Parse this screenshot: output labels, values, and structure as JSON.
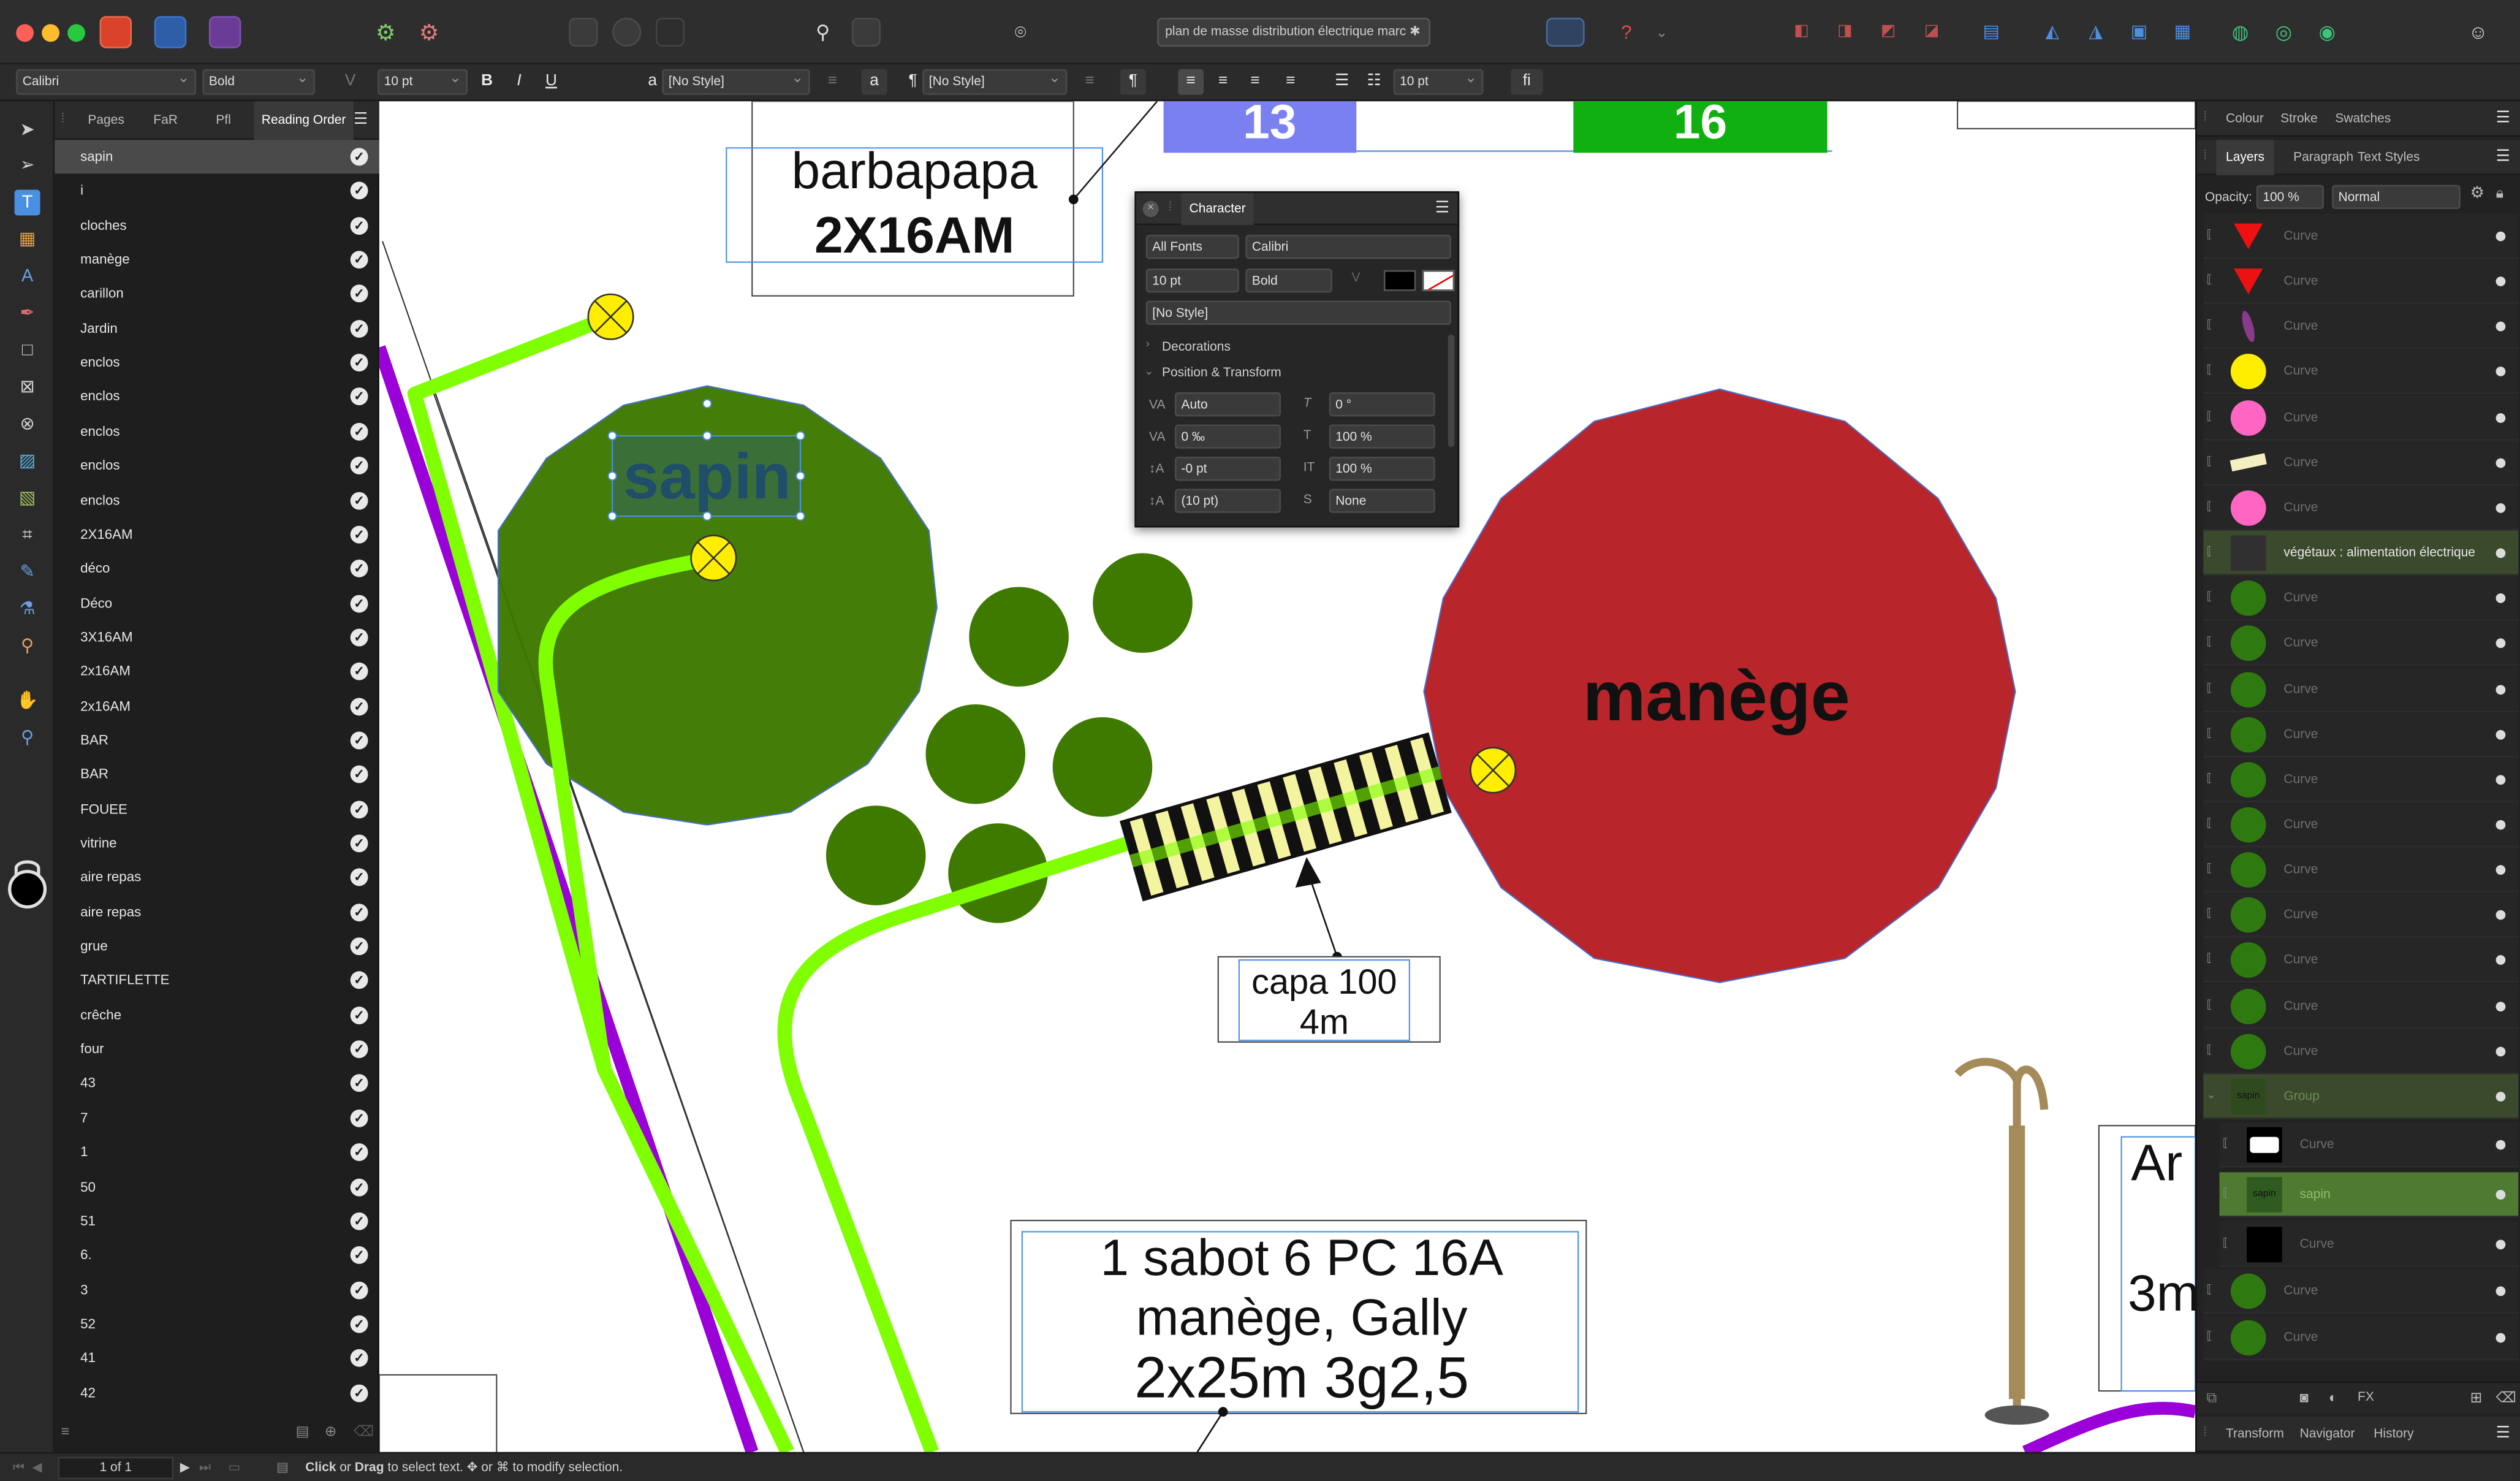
{
  "titlebar": {
    "document_name": "plan de masse distribution électrique marc",
    "modified_marker": "✱"
  },
  "context_toolbar": {
    "font_family": "Calibri",
    "font_style": "Bold",
    "font_size": "10 pt",
    "bold": "B",
    "italic": "I",
    "underline": "U",
    "char_style_prefix": "a",
    "char_style": "[No Style]",
    "para_style_prefix": "¶",
    "para_style": "[No Style]",
    "para_size": "10 pt",
    "ligature": "fi",
    "lowercase_a": "a",
    "pilcrow": "¶"
  },
  "left_panel": {
    "tabs": [
      "Pages",
      "FaR",
      "Pfl",
      "Reading Order"
    ],
    "active_tab": "Reading Order",
    "items": [
      "sapin",
      "i",
      "cloches",
      "manège",
      "carillon",
      "Jardin",
      "enclos",
      "enclos",
      "enclos",
      "enclos",
      "enclos",
      "2X16AM",
      "déco",
      "Déco",
      "3X16AM",
      "2x16AM",
      "2x16AM",
      "BAR",
      "BAR",
      "FOUEE",
      "vitrine",
      "aire repas",
      "aire repas",
      "grue",
      "TARTIFLETTE",
      "crêche",
      "four",
      "43",
      "7",
      "1",
      "50",
      "51",
      "6.",
      "3",
      "52",
      "41",
      "42"
    ],
    "selected_index": 0
  },
  "canvas": {
    "label_13": "13",
    "label_16": "16",
    "barbapapa_line1": "barbapapa",
    "barbapapa_line2": "2X16AM",
    "sapin": "sapin",
    "manege": "manège",
    "capa_line1": "capa 100",
    "capa_line2": "4m",
    "sabot_line1": "1 sabot 6 PC 16A",
    "sabot_line2": "manège, Gally",
    "sabot_line3": "2x25m 3g2,5",
    "ar_line1": "Ar",
    "ar_line2": "3m"
  },
  "character_panel": {
    "title": "Character",
    "font_collection": "All Fonts",
    "font_family": "Calibri",
    "font_size": "10 pt",
    "font_style": "Bold",
    "style": "[No Style]",
    "section_decorations": "Decorations",
    "section_position": "Position & Transform",
    "kerning": "Auto",
    "skew": "0 °",
    "tracking": "0 ‰",
    "vertical_scale": "100 %",
    "baseline": "-0 pt",
    "horizontal_scale": "100 %",
    "leading": "(10 pt)",
    "superscript": "None"
  },
  "right_panel": {
    "top_tabs": [
      "Colour",
      "Stroke",
      "Swatches"
    ],
    "layer_tabs": [
      "Layers",
      "Paragraph",
      "Text Styles"
    ],
    "active_layer_tab": "Layers",
    "opacity_label": "Opacity:",
    "opacity_value": "100 %",
    "blend_mode": "Normal",
    "layers": [
      {
        "name": "Curve",
        "thumb": "red-triangle"
      },
      {
        "name": "Curve",
        "thumb": "red-triangle"
      },
      {
        "name": "Curve",
        "thumb": "purple-leaf"
      },
      {
        "name": "Curve",
        "thumb": "yellow-circle"
      },
      {
        "name": "Curve",
        "thumb": "pink-circle"
      },
      {
        "name": "Curve",
        "thumb": "beige-strip"
      },
      {
        "name": "Curve",
        "thumb": "pink-circle"
      },
      {
        "name": "végétaux : alimentation électrique",
        "thumb": "group-dark"
      },
      {
        "name": "Curve",
        "thumb": "green-circle"
      },
      {
        "name": "Curve",
        "thumb": "green-circle"
      },
      {
        "name": "Curve",
        "thumb": "green-circle"
      },
      {
        "name": "Curve",
        "thumb": "green-circle"
      },
      {
        "name": "Curve",
        "thumb": "green-circle"
      },
      {
        "name": "Curve",
        "thumb": "green-circle"
      },
      {
        "name": "Curve",
        "thumb": "green-circle"
      },
      {
        "name": "Curve",
        "thumb": "green-circle"
      },
      {
        "name": "Curve",
        "thumb": "green-circle"
      },
      {
        "name": "Curve",
        "thumb": "green-circle"
      },
      {
        "name": "Curve",
        "thumb": "green-circle"
      },
      {
        "name": "Group",
        "thumb": "sapin-group"
      },
      {
        "name": "Curve",
        "thumb": "white-black"
      },
      {
        "name": "sapin",
        "thumb": "sapin-text"
      },
      {
        "name": "Curve",
        "thumb": "black-square"
      },
      {
        "name": "Curve",
        "thumb": "green-circle"
      },
      {
        "name": "Curve",
        "thumb": "green-circle"
      }
    ],
    "group_thumb_text": "sapin",
    "bottom_tabs": [
      "Transform",
      "Navigator",
      "History"
    ]
  },
  "statusbar": {
    "page": "1 of 1",
    "hint_click": "Click",
    "hint_or": " or ",
    "hint_drag": "Drag",
    "hint_rest": " to select text. ",
    "hint_mod": "✥ or ⌘ to modify selection."
  },
  "colors": {
    "accent_green": "#4e7a32",
    "tree_green": "#3e7a00",
    "lime": "#80ff00",
    "manege_red": "#b8252a",
    "violet": "#9a00d8",
    "label_13": "#7a80f0",
    "label_16": "#10b010"
  }
}
